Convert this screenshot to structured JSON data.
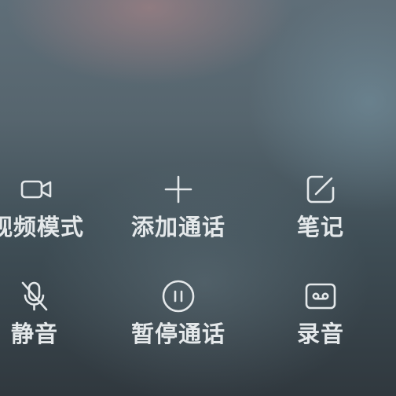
{
  "controls": {
    "video_mode": {
      "label": "视频模式",
      "icon": "video-camera-icon"
    },
    "add_call": {
      "label": "添加通话",
      "icon": "plus-icon"
    },
    "notes": {
      "label": "笔记",
      "icon": "note-edit-icon"
    },
    "mute": {
      "label": "静音",
      "icon": "microphone-off-icon"
    },
    "hold": {
      "label": "暂停通话",
      "icon": "pause-icon"
    },
    "record": {
      "label": "录音",
      "icon": "tape-record-icon"
    }
  },
  "colors": {
    "foreground": "#e4e8ea"
  }
}
